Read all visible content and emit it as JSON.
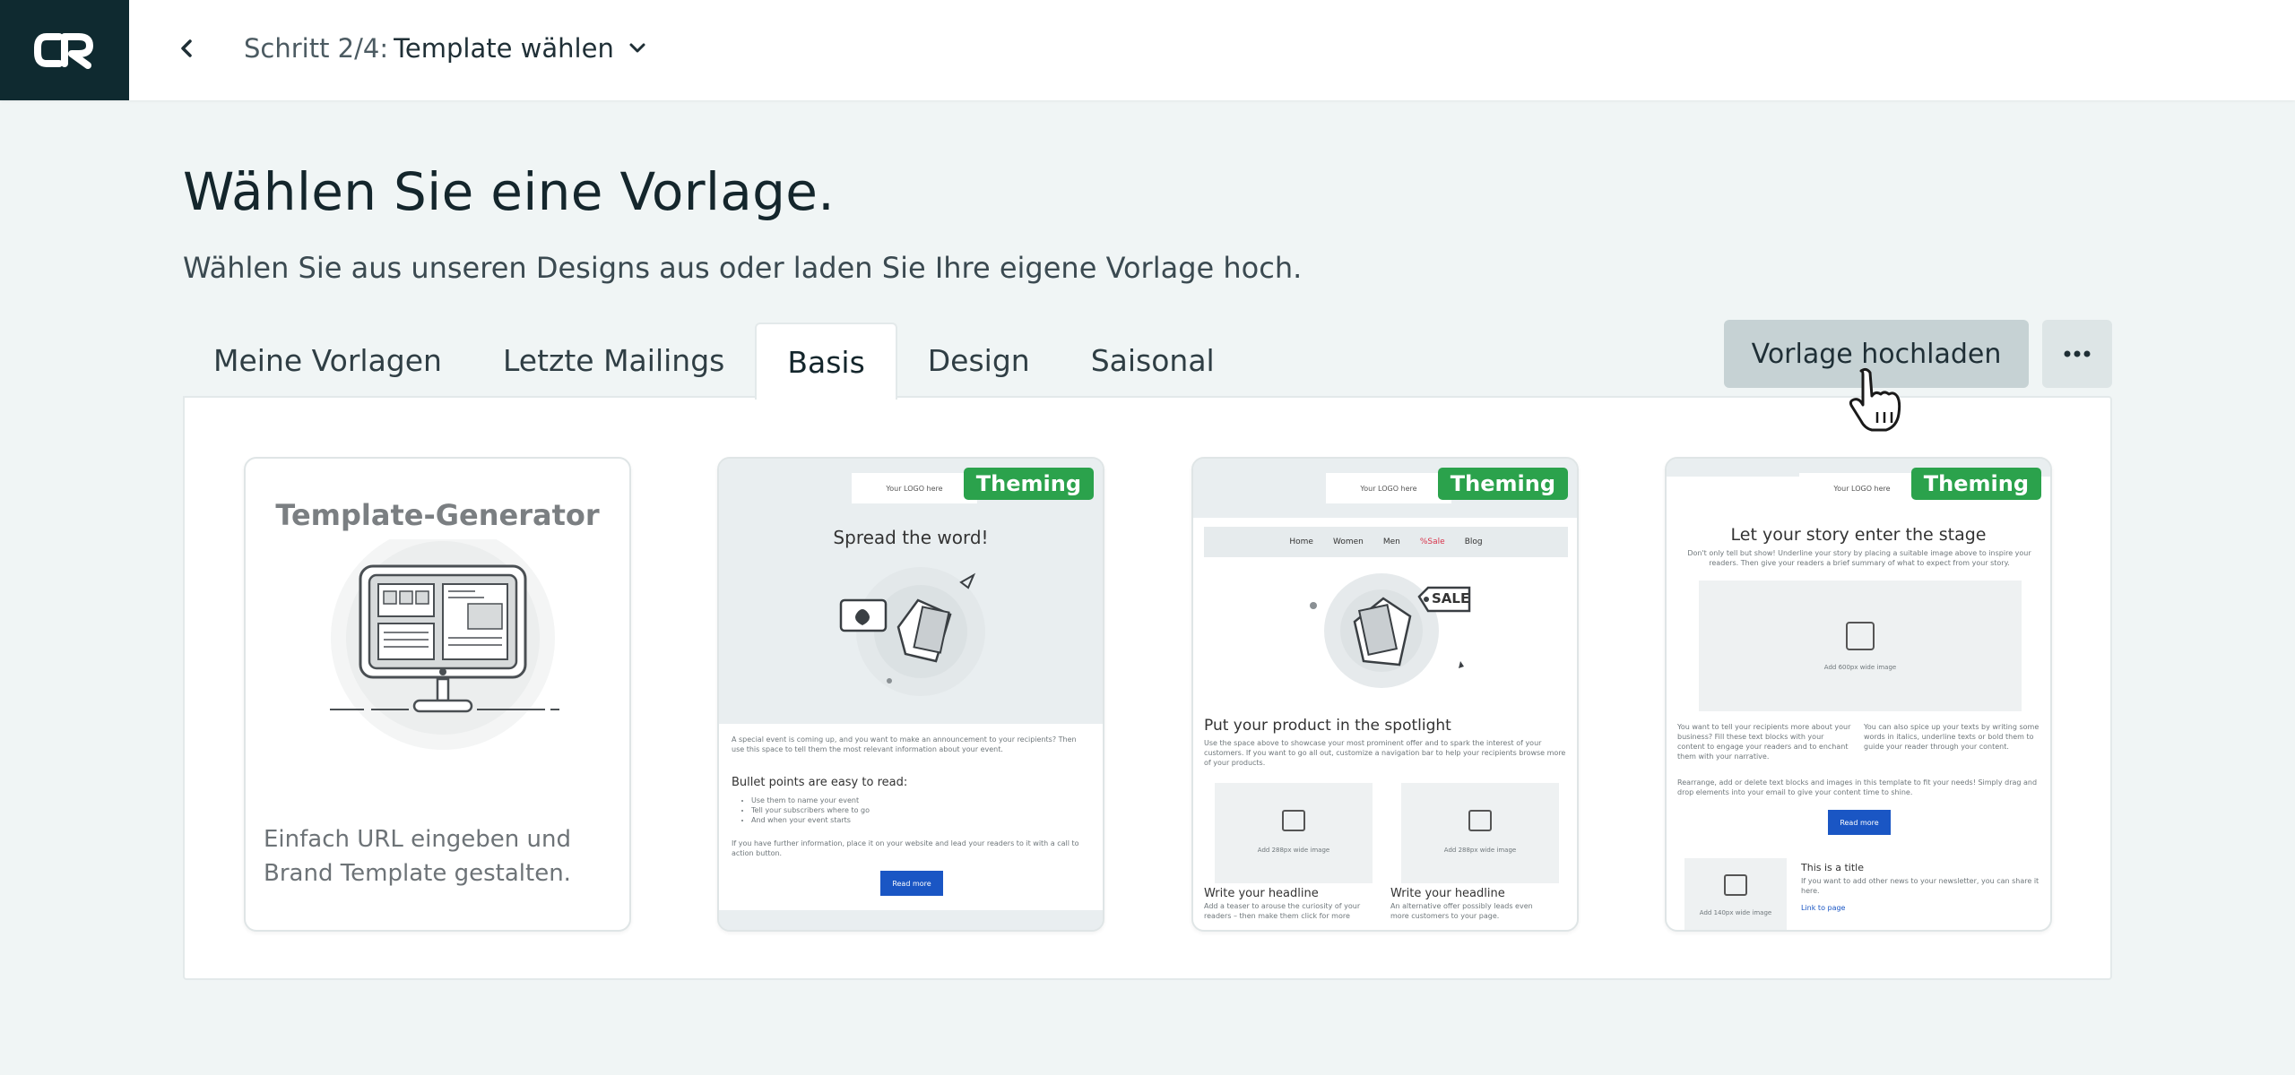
{
  "header": {
    "step_prefix": "Schritt 2/4:",
    "step_title": "Template wählen"
  },
  "page": {
    "title": "Wählen Sie eine Vorlage.",
    "subtitle": "Wählen Sie aus unseren Designs aus oder laden Sie Ihre eigene Vorlage hoch."
  },
  "tabs": [
    {
      "label": "Meine Vorlagen",
      "active": false
    },
    {
      "label": "Letzte Mailings",
      "active": false
    },
    {
      "label": "Basis",
      "active": true
    },
    {
      "label": "Design",
      "active": false
    },
    {
      "label": "Saisonal",
      "active": false
    }
  ],
  "actions": {
    "upload_label": "Vorlage hochladen",
    "more_icon": "ellipsis-icon"
  },
  "cards": {
    "generator": {
      "title": "Template-Generator",
      "description": "Einfach URL eingeben und Brand Template gestalten."
    },
    "badge": "Theming",
    "t1": {
      "logo": "Your LOGO here",
      "headline": "Spread the word!",
      "intro": "A special event is coming up, and you want to make an announcement to your recipients? Then use this space to tell them the most relevant information about your event.",
      "bullets_title": "Bullet points are easy to read:",
      "bullets": [
        "Use them to name your event",
        "Tell your subscribers where to go",
        "And when your event starts"
      ],
      "outro": "If you have further information, place it on your website and lead your readers to it with a call to action button.",
      "button": "Read more"
    },
    "t2": {
      "logo": "Your LOGO here",
      "nav": [
        "Home",
        "Women",
        "Men",
        "%Sale",
        "Blog"
      ],
      "sale_tag": "SALE",
      "headline": "Put your product in the spotlight",
      "intro": "Use the space above to showcase your most prominent offer and to spark the interest of your customers. If you want to go all out, customize a navigation bar to help your recipients browse more of your products.",
      "img_label": "Add 288px wide image",
      "col1_title": "Write your headline",
      "col1_text": "Add a teaser to arouse the curiosity of your readers – then make them click for more",
      "col2_title": "Write your headline",
      "col2_text": "An alternative offer possibly leads even more customers to your page."
    },
    "t3": {
      "logo": "Your LOGO here",
      "headline": "Let your story enter the stage",
      "intro": "Don't only tell but show! Underline your story by placing a suitable image above to inspire your readers. Then give your readers a brief summary of what to expect from your story.",
      "img_label": "Add 600px wide image",
      "col1_text": "You want to tell your recipients more about your business? Fill these text blocks with your content to engage your readers and to enchant them with your narrative.",
      "col2_text": "You can also spice up your texts by writing some words in italics, underline texts or bold them to guide your reader through your content.",
      "para": "Rearrange, add or delete text blocks and images in this template to fit your needs! Simply drag and drop elements into your email to give your content time to shine.",
      "button": "Read more",
      "item_title": "This is a title",
      "item_text": "If you want to add other news to your newsletter, you can share it here.",
      "item_link": "Link to page",
      "small_img_label": "Add 140px wide image"
    }
  }
}
